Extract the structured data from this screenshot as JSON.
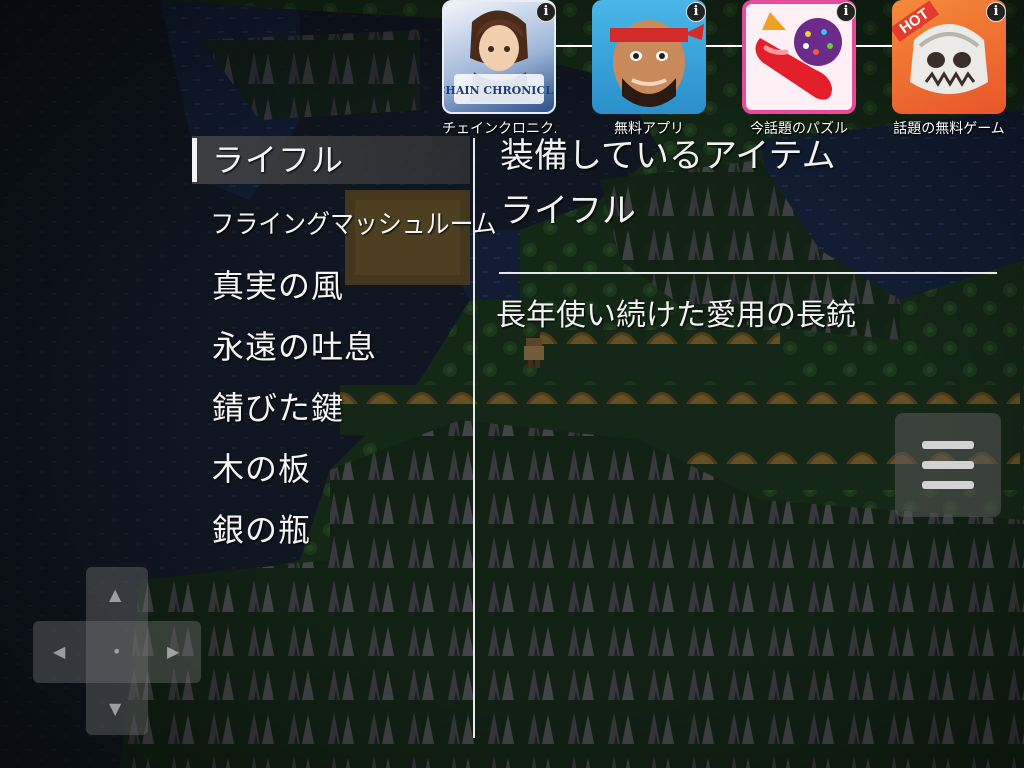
{
  "menu": {
    "items": [
      {
        "label": "ライフル",
        "selected": true
      },
      {
        "label": "フライングマッシュルーム",
        "selected": false
      },
      {
        "label": "真実の風",
        "selected": false
      },
      {
        "label": "永遠の吐息",
        "selected": false
      },
      {
        "label": "錆びた鍵",
        "selected": false
      },
      {
        "label": "木の板",
        "selected": false
      },
      {
        "label": "銀の瓶",
        "selected": false
      }
    ]
  },
  "detail": {
    "heading": "装備しているアイテム",
    "equipped_item": "ライフル",
    "description": "長年使い続けた愛用の長銃"
  },
  "ads": [
    {
      "label": "チェインクロニクル",
      "icon": "chain-chronicle-app-icon",
      "info": "i",
      "icon_text": "CHAIN CHRONICLE"
    },
    {
      "label": "無料アプリ",
      "icon": "boom-beach-app-icon",
      "info": "i"
    },
    {
      "label": "今話題のパズル",
      "icon": "candy-crush-app-icon",
      "info": "i"
    },
    {
      "label": "話題の無料ゲーム",
      "icon": "hot-skull-app-icon",
      "info": "i",
      "badge": "HOT"
    }
  ],
  "controls": {
    "menu_button_icon": "hamburger-menu-icon",
    "dpad_icon": "dpad-icon",
    "arrows": {
      "up": "▲",
      "down": "▼",
      "left": "◀",
      "right": "▶",
      "center": "•"
    }
  },
  "colors": {
    "text": "#f4f4f4",
    "water": "#1b2b4a",
    "grass": "#1d3a1a",
    "sand": "#6b5a2a",
    "selection_bg": "#464646"
  }
}
